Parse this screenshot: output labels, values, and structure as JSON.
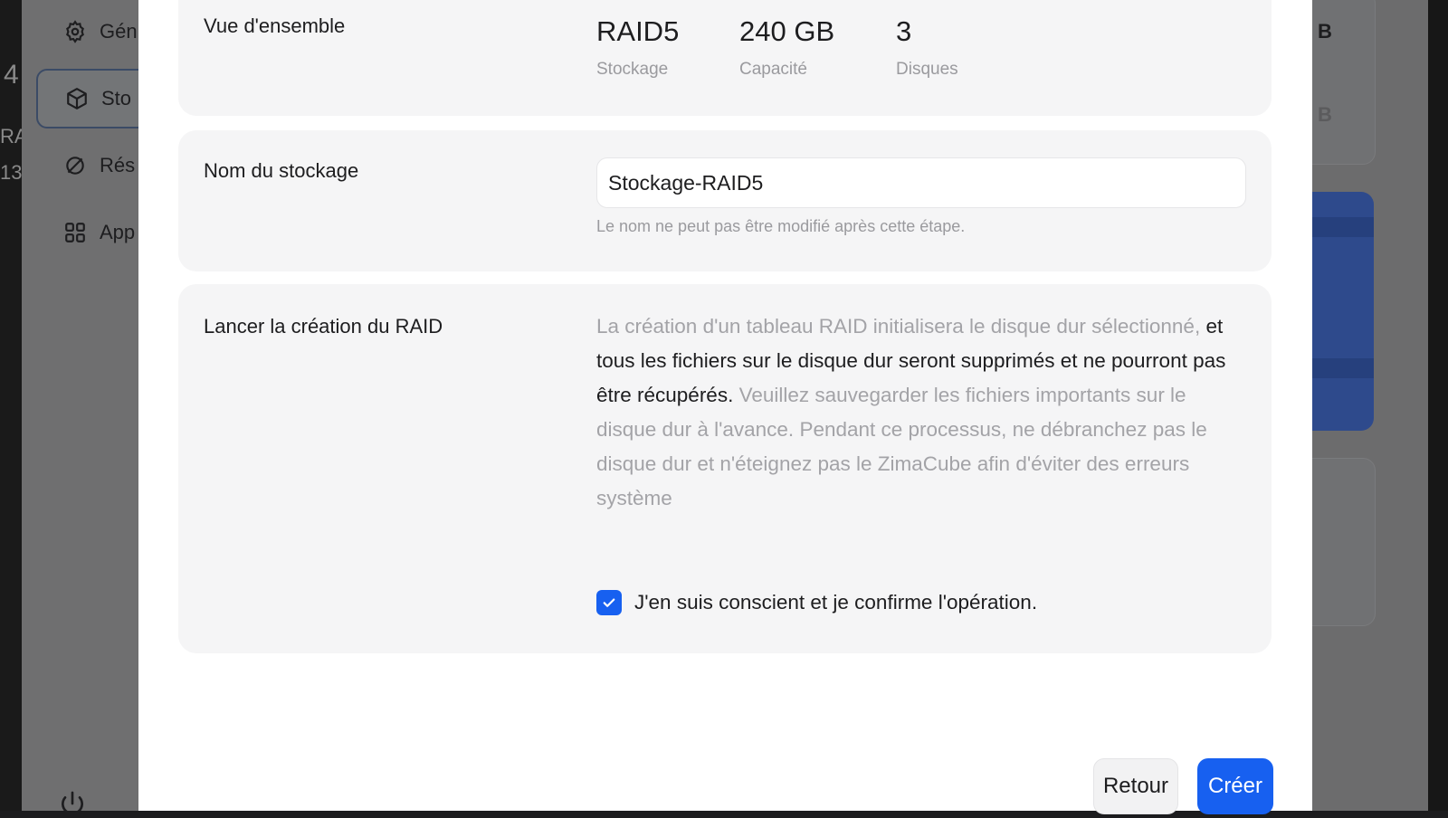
{
  "background": {
    "left_strip_text": [
      "4",
      "RA",
      "13"
    ],
    "sidebar": {
      "items": [
        {
          "label": "Gén",
          "icon": "gear-icon"
        },
        {
          "label": "Sto",
          "icon": "cube-icon",
          "active": true
        },
        {
          "label": "Rés",
          "icon": "network-icon"
        },
        {
          "label": "App",
          "icon": "apps-grid-icon"
        }
      ],
      "power_icon": "power-icon"
    },
    "right_text": [
      "B",
      "B"
    ]
  },
  "modal": {
    "overview": {
      "label": "Vue d'ensemble",
      "stats": [
        {
          "value": "RAID5",
          "caption": "Stockage"
        },
        {
          "value": "240 GB",
          "caption": "Capacité"
        },
        {
          "value": "3",
          "caption": "Disques"
        }
      ]
    },
    "name": {
      "label": "Nom du stockage",
      "value": "Stockage-RAID5",
      "hint": "Le nom ne peut pas être modifié après cette étape."
    },
    "launch": {
      "label": "Lancer la création du RAID",
      "warning_part1": "La création d'un tableau RAID initialisera le disque dur sélectionné,",
      "warning_part2": "et tous les fichiers sur le disque dur seront supprimés et ne pourront pas être récupérés.",
      "warning_part3": "Veuillez sauvegarder les fichiers importants sur le disque dur à l'avance. Pendant ce processus, ne débranchez pas le disque dur et n'éteignez pas le ZimaCube afin d'éviter des erreurs système",
      "confirm_label": "J'en suis conscient et je confirme l'opération.",
      "confirm_checked": true
    },
    "actions": {
      "back_label": "Retour",
      "create_label": "Créer"
    },
    "colors": {
      "accent": "#1760f0",
      "section_bg": "#f5f5f6",
      "muted_text": "#9a9a9e"
    }
  }
}
